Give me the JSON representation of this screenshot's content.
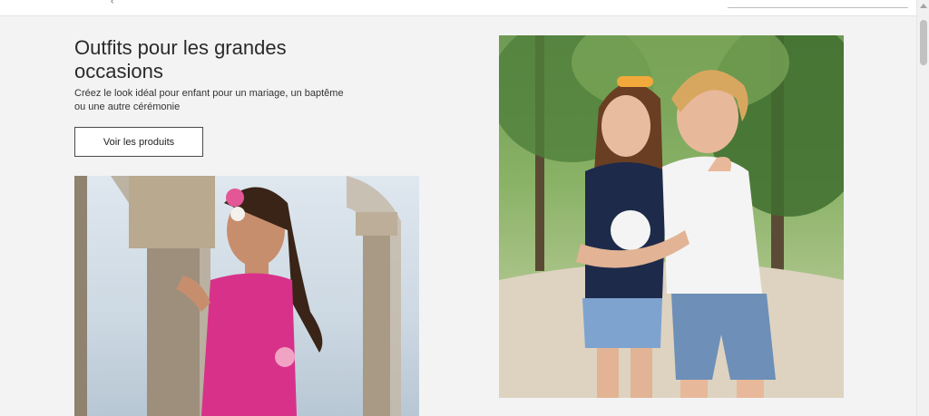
{
  "header": {
    "logo_fragment": "‹"
  },
  "hero": {
    "title": "Outfits pour les grandes occasions",
    "description": "Créez le look idéal pour enfant pour un mariage, un baptême ou une autre cérémonie",
    "cta_label": "Voir les produits"
  },
  "colors": {
    "background": "#f3f3f3",
    "button_border": "#4a4a4a",
    "dress_pink": "#d8318a"
  }
}
